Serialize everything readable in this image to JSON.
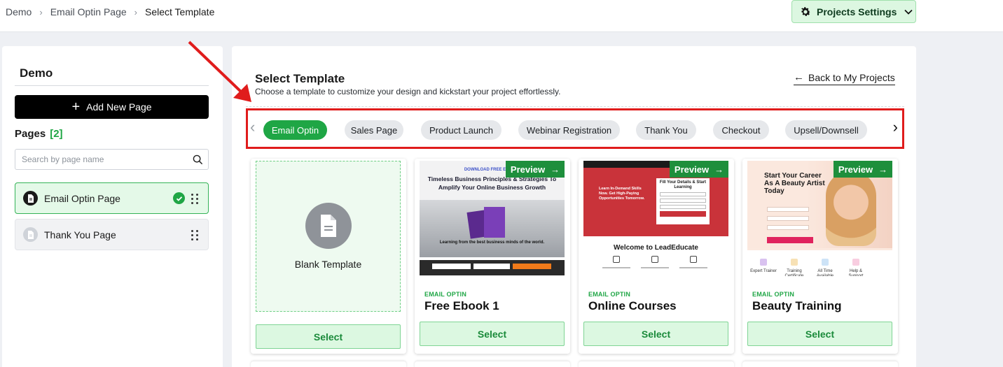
{
  "breadcrumb": [
    "Demo",
    "Email Optin Page",
    "Select Template"
  ],
  "header": {
    "projects_settings_label": "Projects Settings"
  },
  "sidebar": {
    "project_title": "Demo",
    "add_page_label": "Add New Page",
    "pages_heading": "Pages",
    "pages_count": "[2]",
    "search_placeholder": "Search by page name",
    "pages": [
      {
        "label": "Email Optin Page",
        "active": true
      },
      {
        "label": "Thank You Page",
        "active": false
      }
    ]
  },
  "main": {
    "title": "Select Template",
    "subtitle": "Choose a template to customize your design and kickstart your project effortlessly.",
    "back_label": "Back to My Projects",
    "tabs": [
      {
        "label": "Email Optin",
        "selected": true
      },
      {
        "label": "Sales Page",
        "selected": false
      },
      {
        "label": "Product Launch",
        "selected": false
      },
      {
        "label": "Webinar Registration",
        "selected": false
      },
      {
        "label": "Thank You",
        "selected": false
      },
      {
        "label": "Checkout",
        "selected": false
      },
      {
        "label": "Upsell/Downsell",
        "selected": false
      }
    ],
    "cards": [
      {
        "name": "Blank Template",
        "select_label": "Select"
      },
      {
        "category": "EMAIL OPTIN",
        "name": "Free Ebook 1",
        "preview_label": "Preview",
        "select_label": "Select"
      },
      {
        "category": "EMAIL OPTIN",
        "name": "Online Courses",
        "preview_label": "Preview",
        "select_label": "Select"
      },
      {
        "category": "EMAIL OPTIN",
        "name": "Beauty Training",
        "preview_label": "Preview",
        "select_label": "Select"
      }
    ]
  },
  "thumbnails": {
    "ebook": {
      "download": "DOWNLOAD FREE E-BOOK",
      "headline": "Timeless Business Principles & Strategies To Amplify Your Online Business Growth",
      "caption": "Learning from the best business minds of the world."
    },
    "courses": {
      "form_title": "Fill Your Details & Start Learning",
      "hero": "Learn In-Demand Skills Now. Get High-Paying Opportunities Tomorrow.",
      "welcome": "Welcome to LeadEducate"
    },
    "beauty": {
      "headline": "Start Your Career As A Beauty Artist Today",
      "features": [
        "Expert Trainer",
        "Training Certificate",
        "All Time Available",
        "Help & Support"
      ]
    }
  },
  "colors": {
    "accent": "#1fa645",
    "annotation": "#e01c1c",
    "select_bg": "#dcf8e1"
  }
}
